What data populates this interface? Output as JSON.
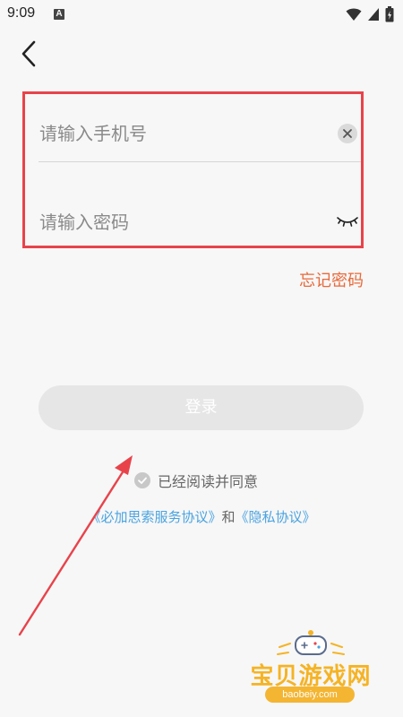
{
  "status_bar": {
    "time": "9:09",
    "notification_letter": "A"
  },
  "form": {
    "phone_placeholder": "请输入手机号",
    "password_placeholder": "请输入密码",
    "forgot_password_label": "忘记密码"
  },
  "login_button_label": "登录",
  "agreement": {
    "text": "已经阅读并同意",
    "service_link": "《必加思索服务协议》",
    "connector": "和",
    "privacy_link": "《隐私协议》"
  },
  "watermark": {
    "title": "宝贝游戏网",
    "url": "baobeiy.com"
  },
  "colors": {
    "highlight_red": "#e8434b",
    "forgot_orange": "#e86a3a",
    "link_blue": "#4aa3e0",
    "login_disabled_gray": "#e6e6e6"
  },
  "icons": {
    "back": "chevron-left-icon",
    "clear": "close-circle-icon",
    "password_visibility": "eye-closed-icon",
    "agree": "check-circle-icon"
  }
}
